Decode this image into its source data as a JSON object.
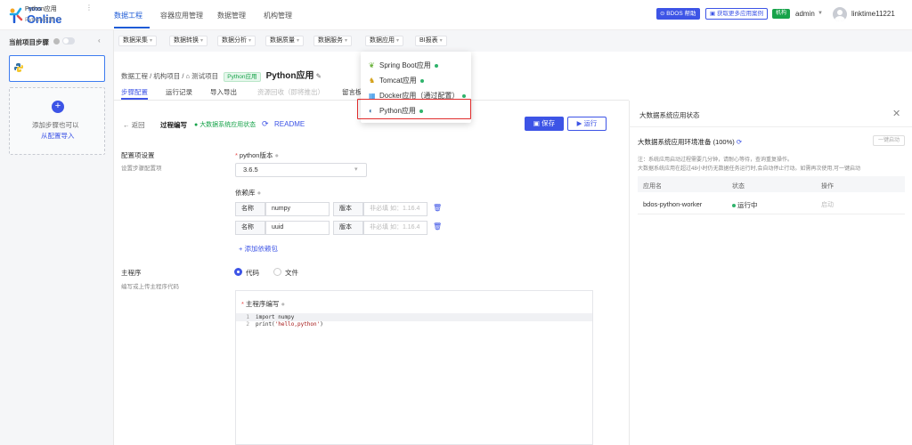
{
  "header": {
    "logo_small": "BDOS",
    "logo_big": "Online",
    "nav": [
      "数据工程",
      "容器应用管理",
      "数据管理",
      "机构管理"
    ],
    "bdos_help": "BDOS 帮助",
    "more_cases": "获取更多应用案例",
    "org_badge": "机构",
    "user": "admin",
    "account": "linktime11221"
  },
  "sidebar": {
    "steps_label": "当前项目步骤",
    "step_title": "Python应用",
    "step_sub": "Python应用",
    "add_step_text": "添加步骤也可以",
    "add_step_link": "从配置导入"
  },
  "toolbar": {
    "tabs": [
      "数据采集",
      "数据转换",
      "数据分析",
      "数据质量",
      "数据服务",
      "数据应用",
      "BI报表"
    ]
  },
  "menu": {
    "items": [
      "Spring Boot应用",
      "Tomcat应用",
      "Docker应用（通过配置）",
      "Python应用"
    ]
  },
  "breadcrumb": {
    "p0": "数据工程",
    "p1": "机构项目",
    "p2": "测试项目",
    "tag": "Python应用",
    "current": "Python应用"
  },
  "subtabs": [
    "步骤配置",
    "运行记录",
    "导入导出",
    "资源回收（即将推出）",
    "留言板"
  ],
  "form": {
    "back": "返回",
    "proc_title": "过程编写",
    "proc_status": "大数据系统应用状态",
    "readme": "README",
    "save": "保存",
    "run": "运行",
    "cfg_title": "配置项设置",
    "cfg_sub": "设置步骤配置项",
    "pyver_label": "python版本",
    "pyver_value": "3.6.5",
    "deps_label": "依赖库",
    "name_label": "名称",
    "version_label": "版本",
    "version_placeholder": "非必填 如：1.16.4",
    "deps": [
      "numpy",
      "uuid"
    ],
    "add_dep": "添加依赖包",
    "main_title": "主程序",
    "main_sub": "编写或上传主程序代码",
    "radio_code": "代码",
    "radio_file": "文件",
    "editor_label": "主程序编写",
    "code_lines": [
      {
        "n": "1",
        "text": "import numpy"
      },
      {
        "n": "2",
        "pre": "print(",
        "str": "'hello,python'",
        "post": ")"
      }
    ]
  },
  "panel": {
    "title": "大数据系统应用状态",
    "env_title": "大数据系统应用环境准备 (100%)",
    "onekey": "一键启动",
    "note1": "注：系统应用启动过程需要几分钟，请耐心等待，查询重复操作。",
    "note2": "大数据系统应用在超过48小时仍无数据任务运行时,会自动停止行动。如需再次使用,可一键启动",
    "columns": [
      "应用名",
      "状态",
      "操作"
    ],
    "row": {
      "name": "bdos-python-worker",
      "status": "运行中",
      "action": "启动"
    }
  }
}
